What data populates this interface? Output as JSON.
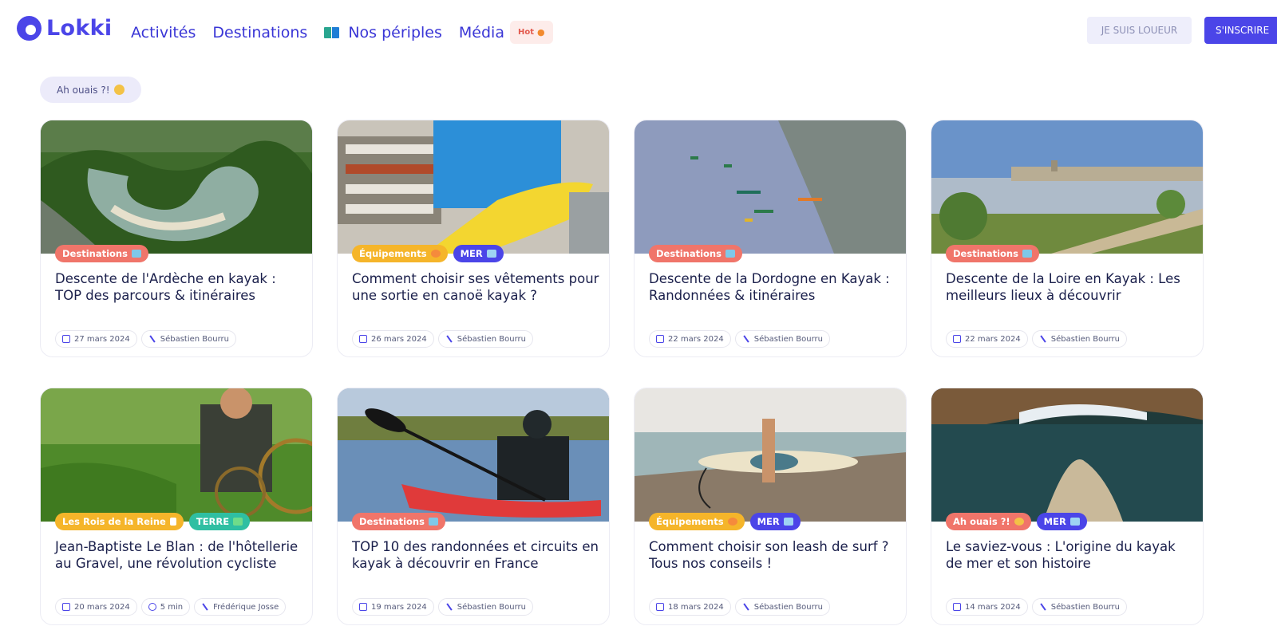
{
  "header": {
    "logo": "Lokki",
    "nav": [
      {
        "label": "Activités"
      },
      {
        "label": "Destinations"
      },
      {
        "label": "Nos périples"
      },
      {
        "label": "Média"
      }
    ],
    "hot_badge": "Hot",
    "btn_loueur": "JE SUIS LOUEUR",
    "btn_inscrire": "S'INSCRIRE"
  },
  "filter": {
    "label": "Ah ouais ?!"
  },
  "cards": [
    {
      "tags": [
        "Destinations"
      ],
      "title": "Descente de l'Ardèche en kayak : TOP des parcours & itinéraires",
      "date": "27 mars 2024",
      "author": "Sébastien Bourru"
    },
    {
      "tags": [
        "Équipements",
        "MER"
      ],
      "title": "Comment choisir ses vêtements pour une sortie en canoë kayak ?",
      "date": "26 mars 2024",
      "author": "Sébastien Bourru"
    },
    {
      "tags": [
        "Destinations"
      ],
      "title": "Descente de la Dordogne en Kayak : Randonnées & itinéraires",
      "date": "22 mars 2024",
      "author": "Sébastien Bourru"
    },
    {
      "tags": [
        "Destinations"
      ],
      "title": "Descente de la Loire en Kayak : Les meilleurs lieux à découvrir",
      "date": "22 mars 2024",
      "author": "Sébastien Bourru"
    },
    {
      "tags": [
        "Les Rois de la Reine",
        "TERRE"
      ],
      "title": "Jean-Baptiste Le Blan : de l'hôtellerie au Gravel, une révolution cycliste",
      "date": "20 mars 2024",
      "duration": "5 min",
      "author": "Frédérique Josse"
    },
    {
      "tags": [
        "Destinations"
      ],
      "title": "TOP 10 des randonnées et circuits en kayak à découvrir en France",
      "date": "19 mars 2024",
      "author": "Sébastien Bourru"
    },
    {
      "tags": [
        "Équipements",
        "MER"
      ],
      "title": "Comment choisir son leash de surf ? Tous nos conseils !",
      "date": "18 mars 2024",
      "author": "Sébastien Bourru"
    },
    {
      "tags": [
        "Ah ouais ?!",
        "MER"
      ],
      "title": "Le saviez-vous : L'origine du kayak de mer et son histoire",
      "date": "14 mars 2024",
      "author": "Sébastien Bourru"
    }
  ],
  "colors": {
    "brand": "#4b45e8",
    "tag_destinations": "#f0756a",
    "tag_equipements": "#f5b52a",
    "tag_mer": "#4b45e8",
    "tag_terre": "#2fbfa2"
  }
}
